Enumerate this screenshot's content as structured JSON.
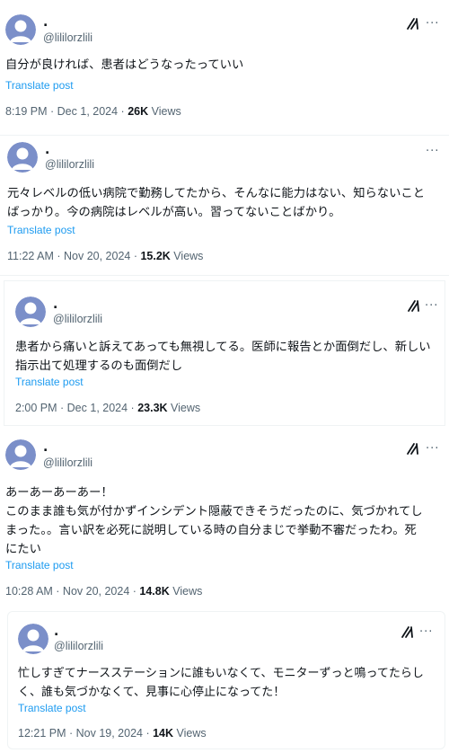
{
  "posts": [
    {
      "name": ".",
      "handle": "@lililorzlili",
      "body": [
        "自分が良ければ、患者はどうなったっていい"
      ],
      "translate": "Translate post",
      "time": "8:19 PM · Dec 1, 2024 · ",
      "views_count": "26K",
      "views_label": " Views",
      "has_grok": true
    },
    {
      "name": ".",
      "handle": "@lililorzlili",
      "body": [
        "元々レベルの低い病院で勤務してたから、そんなに能力はない、知らないこと",
        "ばっかり。今の病院はレベルが高い。習ってないことばかり。"
      ],
      "translate": "Translate post",
      "time": "11:22 AM · Nov 20, 2024 · ",
      "views_count": "15.2K",
      "views_label": " Views",
      "has_grok": false
    },
    {
      "name": ".",
      "handle": "@lililorzlili",
      "body": [
        "患者から痛いと訴えてあっても無視してる。医師に報告とか面倒だし、新しい",
        "指示出て処理するのも面倒だし"
      ],
      "translate": "Translate post",
      "time": "2:00 PM · Dec 1, 2024 · ",
      "views_count": "23.3K",
      "views_label": " Views",
      "has_grok": true
    },
    {
      "name": ".",
      "handle": "@lililorzlili",
      "body": [
        "あーあーあーあー！",
        "このまま誰も気が付かずインシデント隠蔽できそうだったのに、気づかれてし",
        "まった。。言い訳を必死に説明している時の自分まじで挙動不審だったわ。死",
        "にたい"
      ],
      "translate": "Translate post",
      "time": "10:28 AM · Nov 20, 2024 · ",
      "views_count": "14.8K",
      "views_label": " Views",
      "has_grok": true
    },
    {
      "name": ".",
      "handle": "@lililorzlili",
      "body": [
        "忙しすぎてナースステーションに誰もいなくて、モニターずっと鳴ってたらし",
        "く、誰も気づかなくて、見事に心停止になってた！"
      ],
      "translate": "Translate post",
      "time": "12:21 PM · Nov 19, 2024 · ",
      "views_count": "14K",
      "views_label": " Views",
      "has_grok": true
    }
  ],
  "colors": {
    "accent": "#1d9bf0",
    "secondary_text": "#536471",
    "avatar_bg": "#7b8fc9"
  },
  "icons": {
    "avatar": "default-avatar-icon",
    "more": "more-options-icon",
    "grok": "grok-icon"
  }
}
